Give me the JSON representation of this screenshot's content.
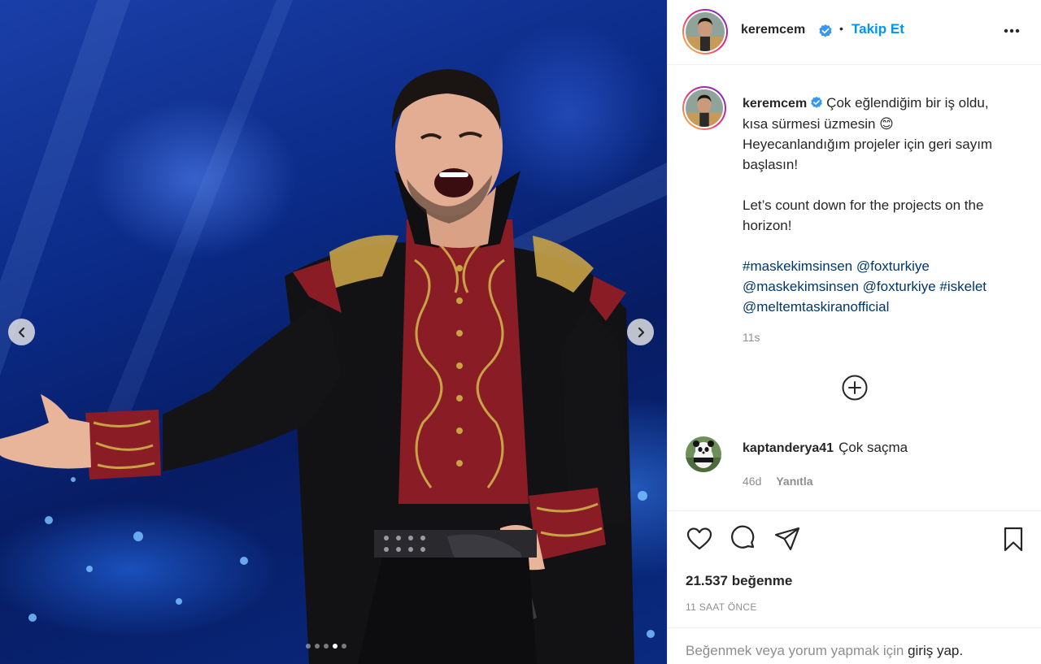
{
  "header": {
    "username": "keremcem",
    "separator": "•",
    "follow_label": "Takip Et",
    "avatar_icon": "profile-photo",
    "verified_icon": "verified-badge-icon",
    "more_icon": "more-options-icon"
  },
  "media": {
    "carousel_count": 5,
    "active_index": 3,
    "prev_icon": "chevron-left-icon",
    "next_icon": "chevron-right-icon"
  },
  "caption": {
    "username": "keremcem",
    "line1": "Çok eğlendiğim bir iş oldu,",
    "line2": "kısa sürmesi üzmesin",
    "emoji": "😊",
    "line3": "Heyecanlandığım projeler için geri sayım",
    "line4": "başlasın!",
    "line5": "Let’s count down for the projects on the",
    "line6": "horizon!",
    "hashtags_row1": [
      "#maskekimsinsen",
      "@foxturkiye"
    ],
    "hashtags_row2": [
      "@maskekimsinsen",
      "@foxturkiye",
      "#iskelet"
    ],
    "hashtags_row3": [
      "@meltemtaskiranofficial"
    ],
    "time_ago": "11s"
  },
  "load_more_icon": "plus-circle-icon",
  "comment": {
    "username": "kaptanderya41",
    "text": "Çok saçma",
    "time_ago": "46d",
    "reply_label": "Yanıtla"
  },
  "actions": {
    "like_icon": "heart-icon",
    "comment_icon": "comment-icon",
    "share_icon": "paper-plane-icon",
    "save_icon": "bookmark-icon"
  },
  "likes_text": "21.537 beğenme",
  "posted_time": "11 SAAT ÖNCE",
  "login_prompt": {
    "prefix": "Beğenmek veya yorum yapmak için",
    "link": "giriş yap."
  },
  "colors": {
    "accent_link": "#0095f6",
    "hashtag": "#00376b",
    "secondary_text": "#8e8e8e",
    "stage_blue": "#0b2a86",
    "costume_red": "#8a1c26",
    "costume_gold": "#c8a245"
  }
}
